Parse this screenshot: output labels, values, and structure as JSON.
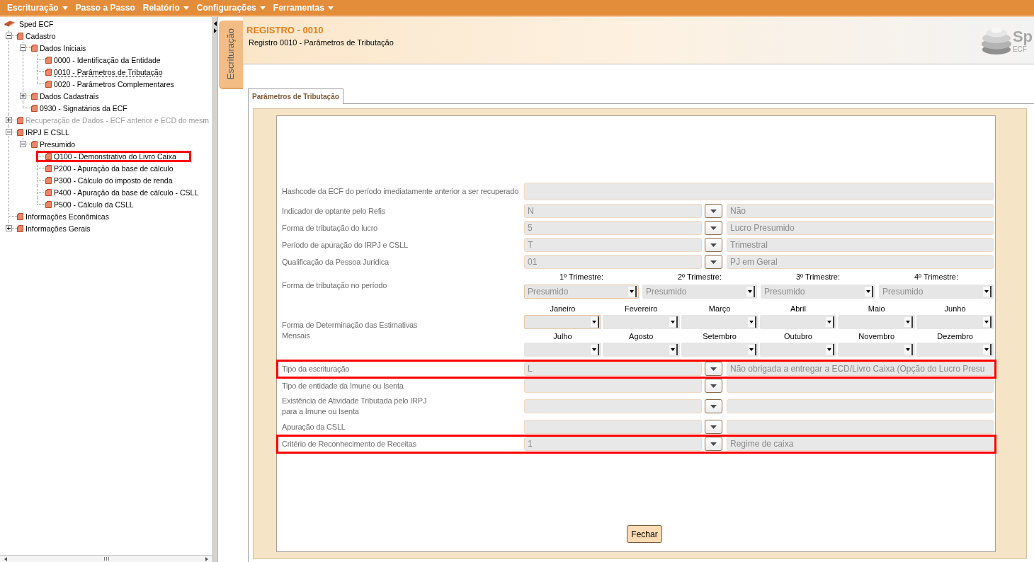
{
  "menu": [
    {
      "label": "Escrituração",
      "submenu": true
    },
    {
      "label": "Passo a Passo",
      "submenu": false
    },
    {
      "label": "Relatório",
      "submenu": true
    },
    {
      "label": "Configurações",
      "submenu": true
    },
    {
      "label": "Ferramentas",
      "submenu": true
    }
  ],
  "tree": [
    {
      "label": "Sped ECF",
      "kind": "root",
      "selected": false,
      "disabled": false,
      "highlighted": false,
      "children": [
        {
          "label": "Cadastro",
          "kind": "group",
          "expanded": true,
          "selected": false,
          "disabled": false,
          "highlighted": false,
          "children": [
            {
              "label": "Dados Iniciais",
              "kind": "group",
              "expanded": true,
              "selected": false,
              "disabled": false,
              "highlighted": false,
              "children": [
                {
                  "label": "0000 - Identificação da Entidade",
                  "kind": "record",
                  "selected": false,
                  "disabled": false,
                  "highlighted": false
                },
                {
                  "label": "0010 - Parâmetros de Tributação",
                  "kind": "record",
                  "selected": true,
                  "disabled": false,
                  "highlighted": false
                },
                {
                  "label": "0020 - Parâmetros Complementares",
                  "kind": "record",
                  "selected": false,
                  "disabled": false,
                  "highlighted": false
                }
              ]
            },
            {
              "label": "Dados Cadastrais",
              "kind": "group",
              "expanded": false,
              "selected": false,
              "disabled": false,
              "highlighted": false
            },
            {
              "label": "0930 - Signatários da ECF",
              "kind": "record",
              "selected": false,
              "disabled": false,
              "highlighted": false
            }
          ]
        },
        {
          "label": "Recuperação de Dados - ECF anterior e ECD do mesm",
          "kind": "group",
          "expanded": false,
          "selected": false,
          "disabled": true,
          "highlighted": false
        },
        {
          "label": "IRPJ E CSLL",
          "kind": "group",
          "expanded": true,
          "selected": false,
          "disabled": false,
          "highlighted": false,
          "children": [
            {
              "label": "Presumido",
              "kind": "group",
              "expanded": true,
              "selected": false,
              "disabled": false,
              "highlighted": false,
              "children": [
                {
                  "label": "Q100 - Demonstrativo do Livro Caixa",
                  "kind": "record",
                  "selected": false,
                  "disabled": false,
                  "highlighted": true
                },
                {
                  "label": "P200 - Apuração da base de cálculo",
                  "kind": "record",
                  "selected": false,
                  "disabled": false,
                  "highlighted": false
                },
                {
                  "label": "P300 - Cálculo do imposto de renda",
                  "kind": "record",
                  "selected": false,
                  "disabled": false,
                  "highlighted": false
                },
                {
                  "label": "P400 - Apuração da base de cálculo - CSLL",
                  "kind": "record",
                  "selected": false,
                  "disabled": false,
                  "highlighted": false
                },
                {
                  "label": "P500 - Cálculo da CSLL",
                  "kind": "record",
                  "selected": false,
                  "disabled": false,
                  "highlighted": false
                }
              ]
            }
          ]
        },
        {
          "label": "Informações Econômicas",
          "kind": "record",
          "selected": false,
          "disabled": false,
          "highlighted": false
        },
        {
          "label": "Informações Gerais",
          "kind": "group",
          "expanded": false,
          "selected": false,
          "disabled": false,
          "highlighted": false
        }
      ]
    }
  ],
  "side_tab": {
    "label": "Escrituração"
  },
  "header": {
    "title": "REGISTRO - 0010",
    "subtitle": "Registro 0010 - Parâmetros de Tributação",
    "logo": {
      "text": "Sp",
      "subtext": "ECF"
    }
  },
  "tabs": [
    {
      "label": "Parâmetros de Tributação",
      "selected": true
    }
  ],
  "form": {
    "rows": [
      {
        "kind": "text",
        "label": "Hashcode da ECF do período imediatamente anterior a ser recuperado",
        "highlighted": false
      },
      {
        "kind": "lookup",
        "label": "Indicador de optante pelo Refis",
        "code": "N",
        "description": "Não",
        "highlighted": false
      },
      {
        "kind": "lookup",
        "label": "Forma de tributação do lucro",
        "code": "5",
        "description": "Lucro Presumido",
        "highlighted": false
      },
      {
        "kind": "lookup",
        "label": "Período de apuração do IRPJ e CSLL",
        "code": "T",
        "description": "Trimestral",
        "highlighted": false
      },
      {
        "kind": "lookup",
        "label": "Qualificação da Pessoa Jurídica",
        "code": "01",
        "description": "PJ em Geral",
        "highlighted": false
      },
      {
        "kind": "quarters",
        "label": "Forma de tributação no período",
        "highlighted": false,
        "selects": [
          {
            "heading": "1º Trimestre:",
            "value": "Presumido",
            "focused": true
          },
          {
            "heading": "2º Trimestre:",
            "value": "Presumido",
            "focused": false
          },
          {
            "heading": "3º Trimestre:",
            "value": "Presumido",
            "focused": false
          },
          {
            "heading": "4º Trimestre:",
            "value": "Presumido",
            "focused": false
          }
        ]
      },
      {
        "kind": "months",
        "label": "Forma de Determinação das Estimativas Mensais",
        "highlighted": false,
        "selects": [
          {
            "heading": "Janeiro",
            "focused": true
          },
          {
            "heading": "Fevereiro",
            "focused": false
          },
          {
            "heading": "Março",
            "focused": false
          },
          {
            "heading": "Abril",
            "focused": false
          },
          {
            "heading": "Maio",
            "focused": false
          },
          {
            "heading": "Junho",
            "focused": false
          },
          {
            "heading": "Julho",
            "focused": false
          },
          {
            "heading": "Agosto",
            "focused": false
          },
          {
            "heading": "Setembro",
            "focused": false
          },
          {
            "heading": "Outubro",
            "focused": false
          },
          {
            "heading": "Novembro",
            "focused": false
          },
          {
            "heading": "Dezembro",
            "focused": false
          }
        ]
      },
      {
        "kind": "lookup",
        "label": "Tipo da escrituração",
        "code": "L",
        "description": "Não obrigada a entregar a ECD/Livro Caixa (Opção do Lucro Presu",
        "highlighted": true
      },
      {
        "kind": "lookup",
        "label": "Tipo de entidade da Imune ou Isenta",
        "highlighted": false
      },
      {
        "kind": "lookup",
        "label": "Existência de Atividade Tributada pelo IRPJ para a Imune ou Isenta",
        "highlighted": false
      },
      {
        "kind": "lookup",
        "label": "Apuração da CSLL",
        "highlighted": false
      },
      {
        "kind": "lookup",
        "label": "Critério de Reconhecimento de Receitas",
        "code": "1",
        "description": "Regime de caixa",
        "highlighted": true
      }
    ],
    "button": {
      "label": "Fechar"
    }
  }
}
